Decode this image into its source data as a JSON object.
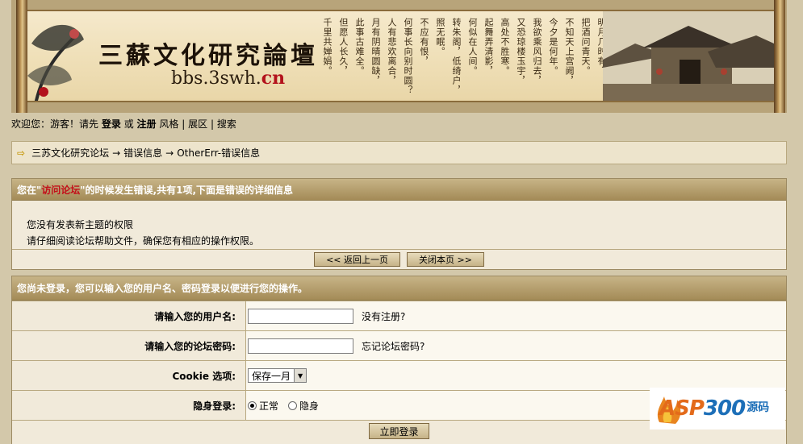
{
  "banner": {
    "logo_title": "三蘇文化研究論壇",
    "logo_url_main": "bbs.3swh.",
    "logo_url_tld": "cn",
    "poem_columns": [
      "明月几时有？",
      "把酒问青天。",
      "不知天上宫阙，",
      "今夕是何年。",
      "我欲乘风归去，",
      "又恐琼楼玉宇，",
      "高处不胜寒。",
      "起舞弄清影，",
      "何似在人间。",
      "转朱阁，低绮户，",
      "照无眠。",
      "不应有恨，",
      "何事长向别时圆？",
      "人有悲欢离合，",
      "月有阴晴圆缺，",
      "此事古难全。",
      "但愿人长久，",
      "千里共婵娟。"
    ]
  },
  "topnav": {
    "welcome": "欢迎您：游客！请先",
    "login": "登录",
    "or": "或",
    "register": "注册",
    "style": "风格",
    "expand": "展区",
    "search": "搜索",
    "sep": "|"
  },
  "breadcrumb": {
    "items": [
      "三苏文化研究论坛",
      "错误信息",
      "OtherErr-错误信息"
    ],
    "sep": "→"
  },
  "error_box": {
    "head_prefix": "您在\"",
    "head_highlight": "访问论坛",
    "head_suffix": "\"的时候发生错误,共有1项,下面是错误的详细信息",
    "line1": "您没有发表新主题的权限",
    "line2": "请仔细阅读论坛帮助文件，确保您有相应的操作权限。",
    "back_button": "<< 返回上一页",
    "close_button": "关闭本页 >>"
  },
  "login_box": {
    "head": "您尚未登录，您可以输入您的用户名、密码登录以便进行您的操作。",
    "username_label": "请输入您的用户名:",
    "username_value": "",
    "no_register": "没有注册?",
    "password_label": "请输入您的论坛密码:",
    "password_value": "",
    "forgot_password": "忘记论坛密码?",
    "cookie_label": "Cookie 选项:",
    "cookie_selected": "保存一月",
    "hidden_label": "隐身登录:",
    "radio_normal": "正常",
    "radio_hidden": "隐身",
    "submit_button": "立即登录"
  },
  "watermark": {
    "brand_letters": "ASP",
    "brand_numbers": "300",
    "sub": "源码"
  }
}
